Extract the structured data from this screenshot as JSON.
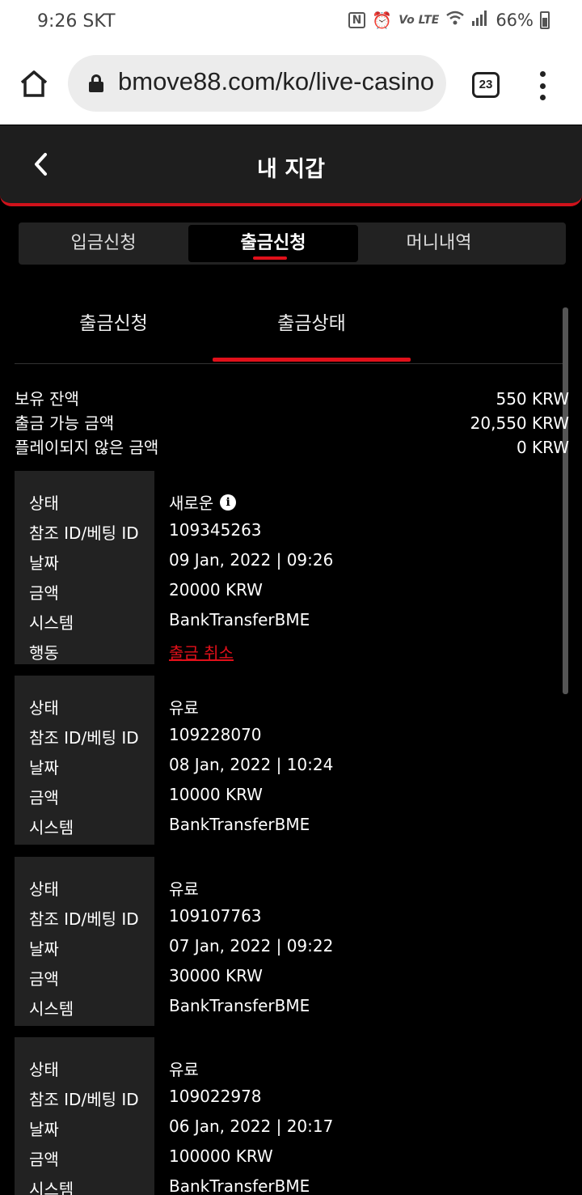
{
  "status_bar": {
    "time": "9:26 SKT",
    "nfc": "N",
    "alarm": "⏰",
    "volte": "Vo LTE",
    "wifi": "wifi",
    "signal": "signal",
    "battery": "66%"
  },
  "browser": {
    "url": "bmove88.com/ko/live-casino",
    "tab_count": "23"
  },
  "header": {
    "title": "내 지갑"
  },
  "main_tabs": [
    {
      "label": "입금신청",
      "active": false
    },
    {
      "label": "출금신청",
      "active": true
    },
    {
      "label": "머니내역",
      "active": false
    }
  ],
  "sub_tabs": [
    {
      "label": "출금신청",
      "active": false
    },
    {
      "label": "출금상태",
      "active": true
    }
  ],
  "balances": [
    {
      "label": "보유 잔액",
      "value": "550 KRW"
    },
    {
      "label": "출금 가능 금액",
      "value": "20,550 KRW"
    },
    {
      "label": "플레이되지 않은 금액",
      "value": "0 KRW"
    }
  ],
  "field_labels": {
    "status": "상태",
    "ref": "참조 ID/베팅 ID",
    "date": "날짜",
    "amount": "금액",
    "system": "시스템",
    "action": "행동"
  },
  "transactions": [
    {
      "status": "새로운",
      "ref": "109345263",
      "date": "09 Jan, 2022 | 09:26",
      "amount": "20000 KRW",
      "system": "BankTransferBME",
      "action": "출금 취소"
    },
    {
      "status": "유료",
      "ref": "109228070",
      "date": "08 Jan, 2022 | 10:24",
      "amount": "10000 KRW",
      "system": "BankTransferBME"
    },
    {
      "status": "유료",
      "ref": "109107763",
      "date": "07 Jan, 2022 | 09:22",
      "amount": "30000 KRW",
      "system": "BankTransferBME"
    },
    {
      "status": "유료",
      "ref": "109022978",
      "date": "06 Jan, 2022 | 20:17",
      "amount": "100000 KRW",
      "system": "BankTransferBME"
    }
  ],
  "colors": {
    "accent": "#e0101a",
    "background": "#000000",
    "panel": "#222222"
  }
}
